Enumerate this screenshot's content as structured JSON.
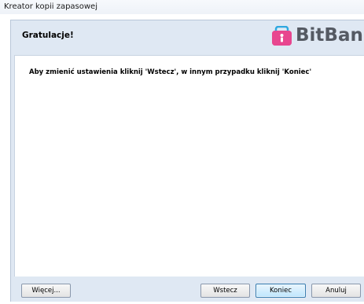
{
  "window": {
    "title": "Kreator kopii zapasowej"
  },
  "header": {
    "title": "Gratulacje!",
    "logo_text": "BitBank",
    "logo_icon": "bitbank-logo-icon"
  },
  "main": {
    "message": "Aby zmienić ustawienia kliknij 'Wstecz', w innym przypadku kliknij 'Koniec'"
  },
  "buttons": {
    "more": "Więcej...",
    "back": "Wstecz",
    "finish": "Koniec",
    "cancel": "Anuluj"
  },
  "colors": {
    "header_background": "#dfe8f3",
    "logo_pink": "#e8468f",
    "logo_text": "#555a63",
    "primary_button_border": "#3c7fb1"
  }
}
